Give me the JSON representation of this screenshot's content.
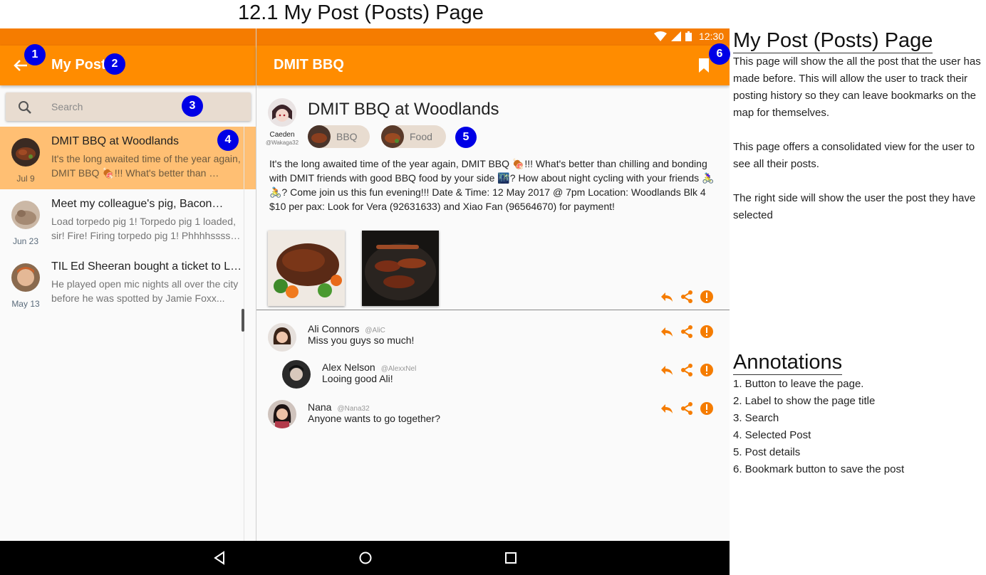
{
  "doc_title": "12.1 My Post (Posts) Page",
  "status_bar": {
    "time": "12:30"
  },
  "left_pane": {
    "title": "My Post",
    "search_placeholder": "Search",
    "posts": [
      {
        "title": "DMIT BBQ at Woodlands",
        "snippet": "It's the long awaited time of the year again, DMIT BBQ 🍖!!! What's better than …",
        "date": "Jul 9",
        "selected": true
      },
      {
        "title": "Meet my colleague's pig, Bacon…",
        "snippet": "Load torpedo pig 1! Torpedo pig 1 loaded, sir! Fire! Firing torpedo pig 1! Phhhhssss…",
        "date": "Jun 23",
        "selected": false
      },
      {
        "title": "TIL Ed Sheeran bought a ticket to LA…",
        "snippet": "He played open mic nights all over the city before he was spotted by Jamie Foxx...",
        "date": "May 13",
        "selected": false
      }
    ]
  },
  "detail": {
    "appbar_title": "DMIT BBQ",
    "title": "DMIT BBQ at Woodlands",
    "author_name": "Caeden",
    "author_handle": "@Wakaga32",
    "tags": [
      "BBQ",
      "Food"
    ],
    "body": "It's the long awaited time of the year again, DMIT BBQ 🍖!!! What's better than chilling and bonding with DMIT friends with good BBQ food by your side 🌃? How about night cycling with your friends 🚴‍♀️🚴? Come join us this fun evening!!! Date & Time: 12 May 2017 @ 7pm Location: Woodlands Blk 4 $10 per pax: Look for Vera (92631633) and Xiao Fan (96564670) for payment!",
    "comments": [
      {
        "name": "Ali Connors",
        "handle": "@AliC",
        "text": "Miss you guys so much!"
      },
      {
        "name": "Alex Nelson",
        "handle": "@AlexxNel",
        "text": "Looing good Ali!"
      },
      {
        "name": "Nana",
        "handle": "@Nana32",
        "text": "Anyone wants to go together?"
      }
    ]
  },
  "badges": [
    "1",
    "2",
    "3",
    "4",
    "5",
    "6"
  ],
  "notes": {
    "heading": "My Post (Posts) Page",
    "paragraphs": [
      "This page will show the all the post that the user has made before. This will allow the user to track their posting history so they can leave bookmarks on the map for themselves.",
      "This page offers a consolidated view for the user to see all their posts.",
      "The right side will show the user the post they have selected"
    ],
    "annotations_heading": "Annotations",
    "annotations": [
      "1. Button to leave the page.",
      "2. Label to show the page title",
      "3. Search",
      "4. Selected Post",
      "5. Post details",
      "6. Bookmark button to save the post"
    ]
  },
  "colors": {
    "appbar": "#ff8c00",
    "status_bar": "#f57c00",
    "selected_row": "#ffbf73",
    "badge": "#0000e6",
    "action_icons": "#f57c00"
  }
}
